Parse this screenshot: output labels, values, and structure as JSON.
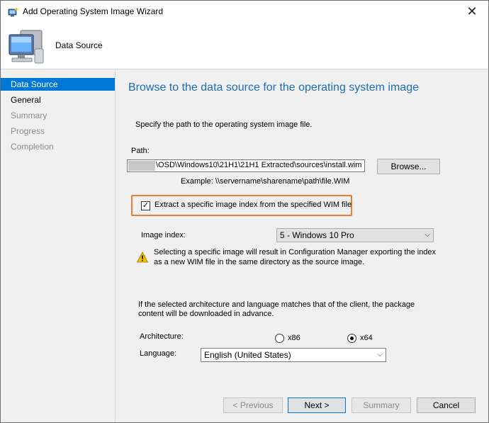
{
  "window": {
    "title": "Add Operating System Image Wizard",
    "close_glyph": "✕"
  },
  "header": {
    "title": "Data Source"
  },
  "sidebar": {
    "items": [
      {
        "label": "Data Source",
        "state": "active"
      },
      {
        "label": "General",
        "state": "current"
      },
      {
        "label": "Summary",
        "state": "inactive"
      },
      {
        "label": "Progress",
        "state": "inactive"
      },
      {
        "label": "Completion",
        "state": "inactive"
      }
    ]
  },
  "main": {
    "heading": "Browse to the data source for the operating system image",
    "instruction": "Specify the path to the operating system image file.",
    "path_label": "Path:",
    "path_value": "\\OSD\\Windows10\\21H1\\21H1 Extracted\\sources\\install.wim",
    "browse_label": "Browse...",
    "example": "Example: \\\\servername\\sharename\\path\\file.WIM",
    "extract_checkbox_label": "Extract a specific image index from the specified WIM file",
    "extract_checked": true,
    "image_index_label": "Image index:",
    "image_index_value": "5 - Windows 10 Pro",
    "warning_line1": "Selecting a specific image will result in Configuration Manager exporting the index",
    "warning_line2": "as a new WIM file in the same directory as the source image.",
    "arch_note_line1": "If the selected architecture and language matches that of the client, the package",
    "arch_note_line2": "content will be downloaded in advance.",
    "architecture_label": "Architecture:",
    "arch_options": [
      {
        "label": "x86",
        "selected": false
      },
      {
        "label": "x64",
        "selected": true
      }
    ],
    "language_label": "Language:",
    "language_value": "English (United States)"
  },
  "footer": {
    "previous_label": "< Previous",
    "next_label": "Next >",
    "summary_label": "Summary",
    "cancel_label": "Cancel"
  },
  "colors": {
    "accent": "#0078d7",
    "heading": "#1e6cb8",
    "highlight": "#ed7d31"
  }
}
